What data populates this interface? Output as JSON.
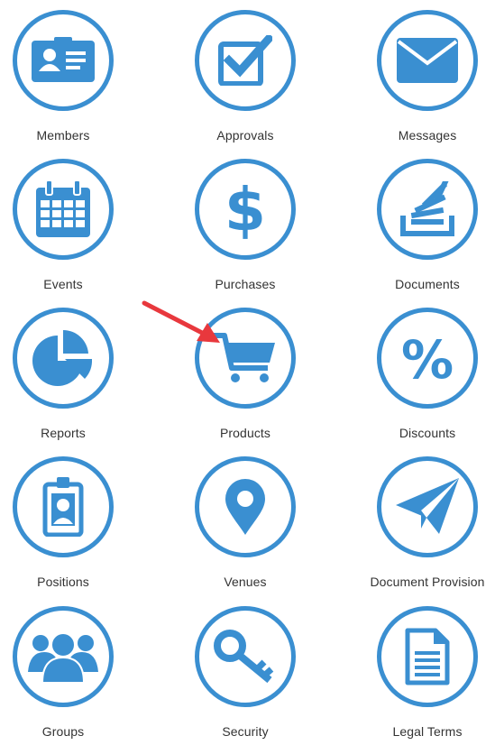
{
  "colors": {
    "accent": "#3a8fd1",
    "label": "#333333",
    "arrow": "#e8383d"
  },
  "tiles": [
    {
      "label": "Members",
      "icon": "member-card-icon"
    },
    {
      "label": "Approvals",
      "icon": "checkbox-icon"
    },
    {
      "label": "Messages",
      "icon": "envelope-icon"
    },
    {
      "label": "Events",
      "icon": "calendar-icon"
    },
    {
      "label": "Purchases",
      "icon": "dollar-icon"
    },
    {
      "label": "Documents",
      "icon": "document-stack-icon"
    },
    {
      "label": "Reports",
      "icon": "pie-chart-icon"
    },
    {
      "label": "Products",
      "icon": "shopping-cart-icon"
    },
    {
      "label": "Discounts",
      "icon": "percent-icon"
    },
    {
      "label": "Positions",
      "icon": "id-badge-icon"
    },
    {
      "label": "Venues",
      "icon": "map-pin-icon"
    },
    {
      "label": "Document Provision",
      "icon": "paper-plane-icon"
    },
    {
      "label": "Groups",
      "icon": "users-group-icon"
    },
    {
      "label": "Security",
      "icon": "key-icon"
    },
    {
      "label": "Legal Terms",
      "icon": "legal-document-icon"
    }
  ]
}
